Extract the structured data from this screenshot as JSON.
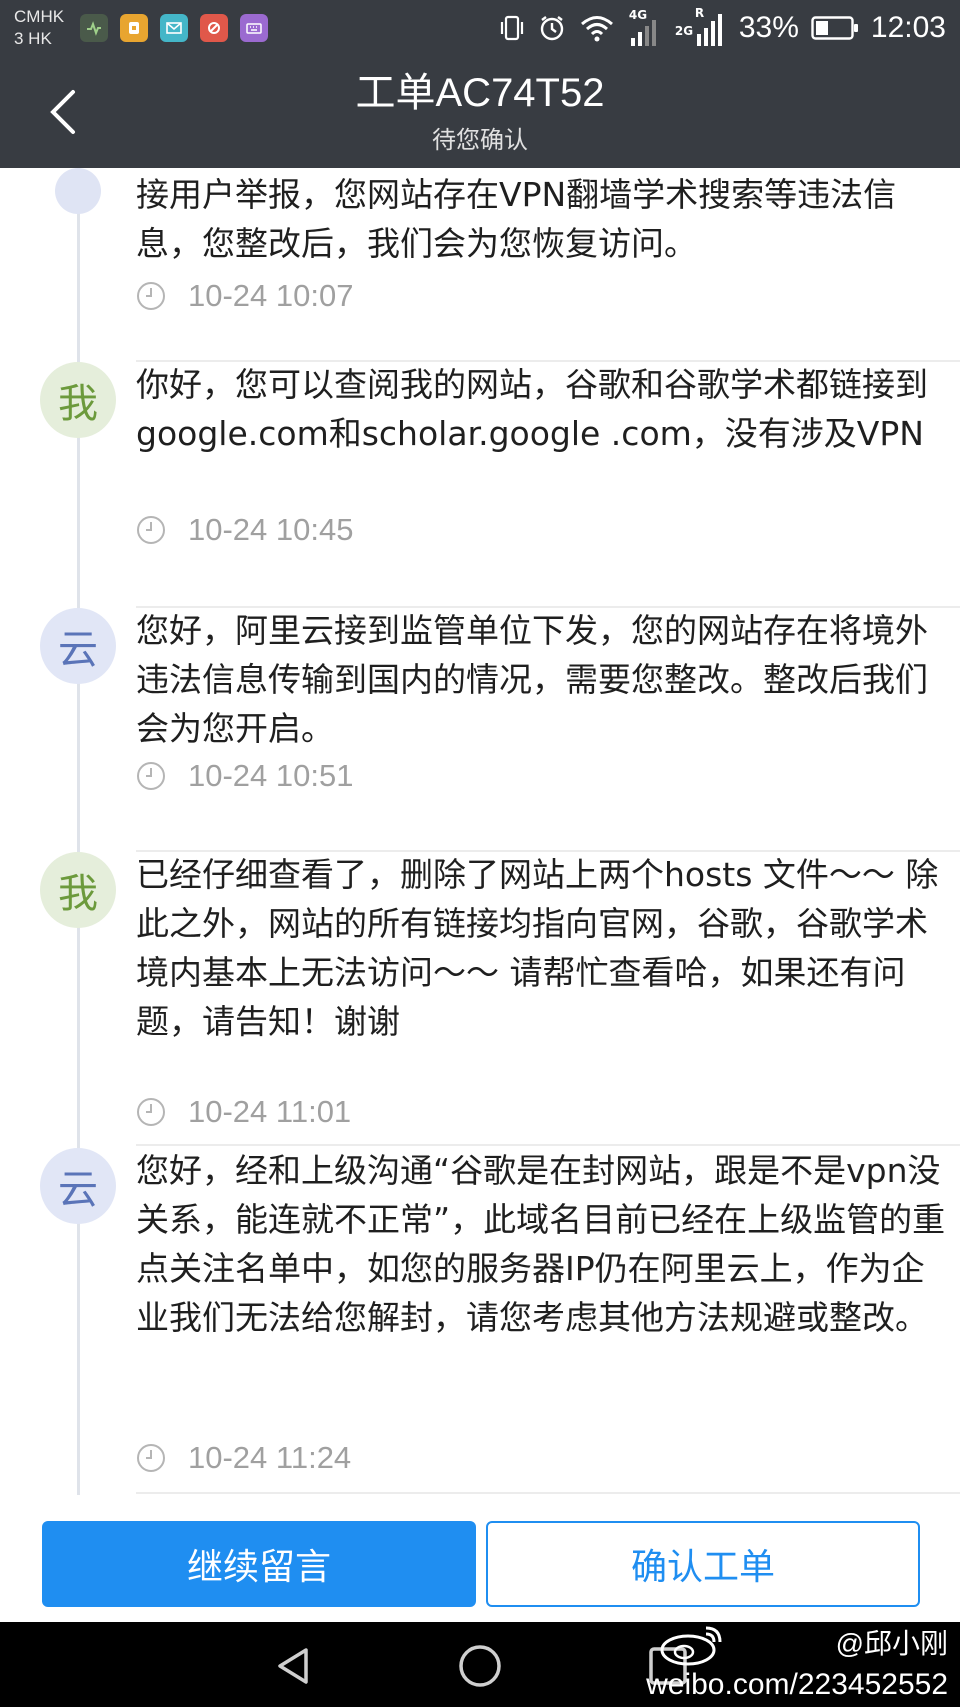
{
  "status_bar": {
    "carrier_line1": "CMHK",
    "carrier_line2": "3 HK",
    "network_4g": "4G",
    "network_2g": "2G",
    "network_r": "R",
    "battery": "33%",
    "time": "12:03"
  },
  "header": {
    "title": "工单AC74T52",
    "subtitle": "待您确认"
  },
  "messages": [
    {
      "author": "",
      "text": "接用户举报，您网站存在VPN翻墙学术搜索等违法信息，您整改后，我们会为您恢复访问。",
      "time": "10-24 10:07"
    },
    {
      "author": "我",
      "text": "你好，您可以查阅我的网站，谷歌和谷歌学术都链接到google.com和scholar.google .com，没有涉及VPN",
      "time": "10-24 10:45"
    },
    {
      "author": "云",
      "text": "您好，阿里云接到监管单位下发，您的网站存在将境外违法信息传输到国内的情况，需要您整改。整改后我们会为您开启。",
      "time": "10-24 10:51"
    },
    {
      "author": "我",
      "text": "已经仔细查看了，删除了网站上两个hosts 文件～～ 除此之外，网站的所有链接均指向官网，谷歌，谷歌学术境内基本上无法访问～～ 请帮忙查看哈，如果还有问题，请告知！谢谢",
      "time": "10-24 11:01"
    },
    {
      "author": "云",
      "text": "您好，经和上级沟通“谷歌是在封网站，跟是不是vpn没关系，能连就不正常”，此域名目前已经在上级监管的重点关注名单中，如您的服务器IP仍在阿里云上，作为企业我们无法给您解封，请您考虑其他方法规避或整改。",
      "time": "10-24 11:24"
    }
  ],
  "actions": {
    "continue_label": "继续留言",
    "confirm_label": "确认工单"
  },
  "watermark": {
    "handle": "@邱小刚",
    "url": "weibo.com/223452552"
  },
  "colors": {
    "header_bg": "#383c42",
    "primary": "#1f8ef1",
    "time_text": "#a0a0a0"
  }
}
